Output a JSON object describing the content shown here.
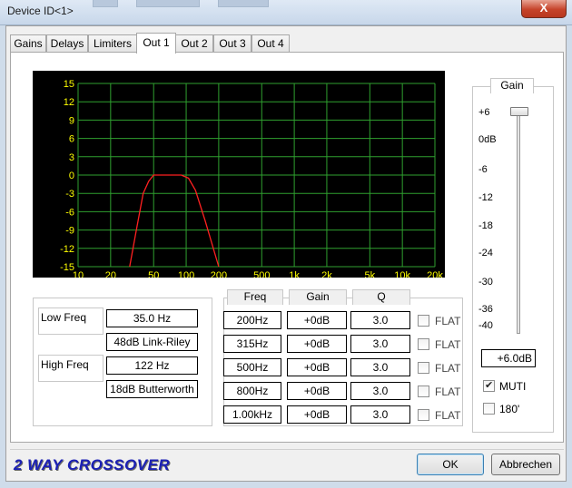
{
  "window": {
    "title": "Device ID<1>",
    "close_label": "X"
  },
  "tabs": [
    {
      "label": "Gains",
      "active": false
    },
    {
      "label": "Delays",
      "active": false
    },
    {
      "label": "Limiters",
      "active": false
    },
    {
      "label": "Out 1",
      "active": true
    },
    {
      "label": "Out 2",
      "active": false
    },
    {
      "label": "Out 3",
      "active": false
    },
    {
      "label": "Out 4",
      "active": false
    }
  ],
  "graph": {
    "y_ticks": [
      "15",
      "12",
      "9",
      "6",
      "3",
      "0",
      "-3",
      "-6",
      "-9",
      "-12",
      "-15"
    ],
    "x_ticks": [
      "10",
      "20",
      "50",
      "100",
      "200",
      "500",
      "1k",
      "2k",
      "5k",
      "10k",
      "20k"
    ],
    "colors": {
      "background": "#000000",
      "grid": "#2fa02f",
      "labels": "#ffff00",
      "curve": "#ff2020"
    },
    "curve": [
      {
        "hz": 30,
        "db": -15
      },
      {
        "hz": 35,
        "db": -8.5
      },
      {
        "hz": 40,
        "db": -3
      },
      {
        "hz": 45,
        "db": -1
      },
      {
        "hz": 50,
        "db": 0
      },
      {
        "hz": 90,
        "db": 0
      },
      {
        "hz": 105,
        "db": -0.5
      },
      {
        "hz": 122,
        "db": -2.5
      },
      {
        "hz": 150,
        "db": -7.5
      },
      {
        "hz": 200,
        "db": -15
      }
    ]
  },
  "crossover": {
    "low_freq_label": "Low Freq",
    "low_freq_value": "35.0 Hz",
    "low_filter": "48dB Link-Riley",
    "high_freq_label": "High Freq",
    "high_freq_value": "122 Hz",
    "high_filter": "18dB Butterworth"
  },
  "eq": {
    "headers": {
      "freq": "Freq",
      "gain": "Gain",
      "q": "Q"
    },
    "flat_label": "FLAT",
    "bands": [
      {
        "freq": "200Hz",
        "gain": "+0dB",
        "q": "3.0",
        "flat": false
      },
      {
        "freq": "315Hz",
        "gain": "+0dB",
        "q": "3.0",
        "flat": false
      },
      {
        "freq": "500Hz",
        "gain": "+0dB",
        "q": "3.0",
        "flat": false
      },
      {
        "freq": "800Hz",
        "gain": "+0dB",
        "q": "3.0",
        "flat": false
      },
      {
        "freq": "1.00kHz",
        "gain": "+0dB",
        "q": "3.0",
        "flat": false
      }
    ]
  },
  "gain_panel": {
    "title": "Gain",
    "scale": [
      "+6",
      "0dB",
      "-6",
      "-12",
      "-18",
      "-24",
      "-30",
      "-36",
      "-40"
    ],
    "value": "+6.0dB",
    "slider_level_db": 6,
    "muti_label": "MUTI",
    "muti_checked": true,
    "phase_label": "180'",
    "phase_checked": false
  },
  "footer": {
    "brand": "2 WAY CROSSOVER",
    "ok_label": "OK",
    "cancel_label": "Abbrechen"
  }
}
